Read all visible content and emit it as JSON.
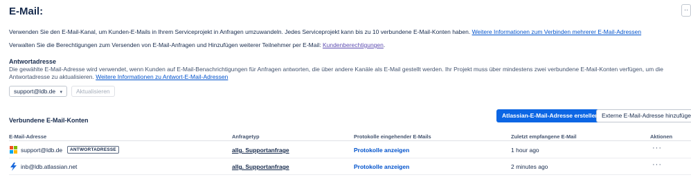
{
  "header": {
    "title": "E-Mail:",
    "more_label": "··"
  },
  "intro": {
    "text1": "Verwenden Sie den E-Mail-Kanal, um Kunden-E-Mails in Ihrem Serviceprojekt in Anfragen umzuwandeln. Jedes Serviceprojekt kann bis zu 10 verbundene E-Mail-Konten haben. ",
    "link1": "Weitere Informationen zum Verbinden mehrerer E-Mail-Adressen",
    "text2": "Verwalten Sie die Berechtigungen zum Versenden von E-Mail-Anfragen und Hinzufügen weiterer Teilnehmer per E-Mail: ",
    "link2": "Kundenberechtigungen",
    "text2_end": "."
  },
  "reply": {
    "heading": "Antwortadresse",
    "description": "Die gewählte E-Mail-Adresse wird verwendet, wenn Kunden auf E-Mail-Benachrichtigungen für Anfragen antworten, die über andere Kanäle als E-Mail gestellt werden. Ihr Projekt muss über mindestens zwei verbundene E-Mail-Konten verfügen, um die Antwortadresse zu aktualisieren. ",
    "link": "Weitere Informationen zu Antwort-E-Mail-Adressen",
    "select_value": "support@ldb.de",
    "update_button": "Aktualisieren"
  },
  "accounts": {
    "heading": "Verbundene E-Mail-Konten",
    "create_button": "Atlassian-E-Mail-Adresse erstellen",
    "add_button": "Externe E-Mail-Adresse hinzufügen",
    "columns": {
      "email": "E-Mail-Adresse",
      "type": "Anfragetyp",
      "logs": "Protokolle eingehender E-Mails",
      "last": "Zuletzt empfangene E-Mail",
      "actions": "Aktionen"
    },
    "rows": [
      {
        "icon": "microsoft-icon",
        "email": "support@ldb.de",
        "badge": "ANTWORTADRESSE",
        "type": "allg. Supportanfrage",
        "logs": "Protokolle anzeigen",
        "last": "1 hour ago",
        "actions": "···"
      },
      {
        "icon": "atlassian-icon",
        "email": "inb@ldb.atlassian.net",
        "badge": "",
        "type": "allg. Supportanfrage",
        "logs": "Protokolle anzeigen",
        "last": "2 minutes ago",
        "actions": "···"
      }
    ]
  },
  "colors": {
    "primary": "#0c66e4",
    "link": "#0052cc",
    "link_visited": "#5e4db2",
    "text": "#172b4d"
  }
}
